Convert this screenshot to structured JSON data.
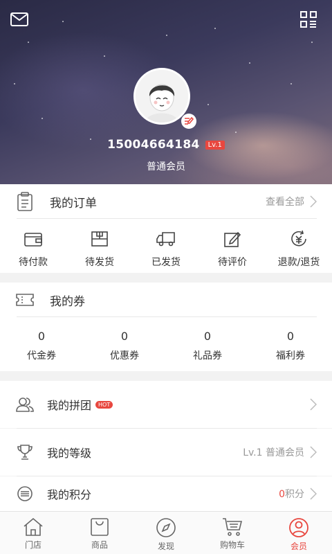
{
  "header": {
    "phone": "15004664184",
    "level_badge": "Lv.1",
    "member_type": "普通会员"
  },
  "orders": {
    "title": "我的订单",
    "view_all": "查看全部",
    "items": [
      {
        "label": "待付款",
        "icon": "wallet-icon"
      },
      {
        "label": "待发货",
        "icon": "package-icon"
      },
      {
        "label": "已发货",
        "icon": "truck-icon"
      },
      {
        "label": "待评价",
        "icon": "edit-icon"
      },
      {
        "label": "退款/退货",
        "icon": "refund-icon"
      }
    ]
  },
  "coupons": {
    "title": "我的券",
    "items": [
      {
        "count": "0",
        "label": "代金券"
      },
      {
        "count": "0",
        "label": "优惠券"
      },
      {
        "count": "0",
        "label": "礼品券"
      },
      {
        "count": "0",
        "label": "福利券"
      }
    ]
  },
  "menu": {
    "group": {
      "label": "我的拼团",
      "badge": "HOT"
    },
    "level": {
      "label": "我的等级",
      "value": "Lv.1 普通会员"
    },
    "points": {
      "label": "我的积分",
      "count": "0",
      "unit": "积分"
    }
  },
  "tabbar": {
    "items": [
      {
        "label": "门店",
        "icon": "home-icon"
      },
      {
        "label": "商品",
        "icon": "bag-icon"
      },
      {
        "label": "发现",
        "icon": "compass-icon"
      },
      {
        "label": "购物车",
        "icon": "cart-icon"
      },
      {
        "label": "会员",
        "icon": "user-icon",
        "active": true
      }
    ]
  },
  "colors": {
    "accent": "#e8473f",
    "text": "#333333",
    "muted": "#999999",
    "background": "#f2f2f2"
  }
}
